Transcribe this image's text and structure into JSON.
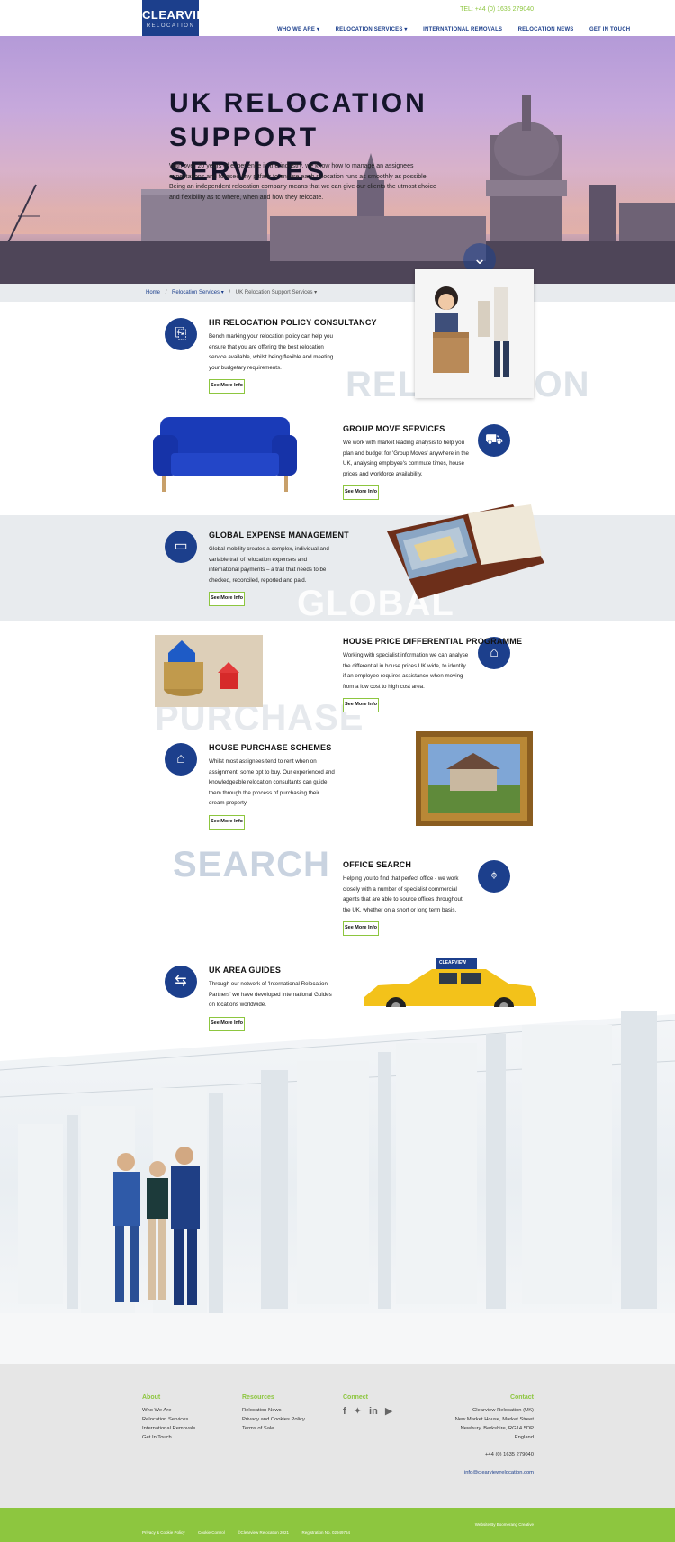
{
  "header": {
    "logo_line1": "CLEARVIEW",
    "logo_line2": "RELOCATION",
    "tel": "TEL: +44 (0) 1635 279040",
    "nav": [
      {
        "label": "WHO WE ARE ▾"
      },
      {
        "label": "RELOCATION SERVICES ▾"
      },
      {
        "label": "INTERNATIONAL REMOVALS"
      },
      {
        "label": "RELOCATION NEWS"
      },
      {
        "label": "GET IN TOUCH"
      }
    ]
  },
  "hero": {
    "title": "UK RELOCATION SUPPORT SERVICES",
    "body": "With over 20 years of experience in the industry, we know how to manage an assignees expectations and foresee any pitfalls to ensure each relocation runs as smoothly as possible. Being an independent relocation company means that we can give our clients the utmost choice and flexibility as to where, when and how they relocate.",
    "scroll_icon": "chevron-down-icon"
  },
  "breadcrumb": {
    "home": "Home",
    "sep": "/",
    "section": "Relocation Services ▾",
    "current": "UK Relocation Support Services ▾"
  },
  "services": [
    {
      "title": "HR RELOCATION POLICY CONSULTANCY",
      "text": "Bench marking your relocation policy can help you ensure that you are offering the best relocation service available, whilst being flexible and meeting your budgetary requirements.",
      "button": "See More Info",
      "icon": "policy-document-icon"
    },
    {
      "title": "GROUP MOVE SERVICES",
      "text": "We work with market leading analysis to help you plan and budget for 'Group Moves' anywhere in the UK, analysing employee's commute times, house prices and workforce availability.",
      "button": "See More Info",
      "icon": "moving-truck-icon"
    },
    {
      "title": "GLOBAL EXPENSE MANAGEMENT",
      "text": "Global mobility creates a complex, individual and variable trail of relocation expenses and international payments – a trail that needs to be checked, reconciled, reported and paid.",
      "button": "See More Info",
      "icon": "wallet-icon"
    },
    {
      "title": "HOUSE PRICE DIFFERENTIAL PROGRAMME",
      "text": "Working with specialist information we can analyse the differential in house prices UK wide, to identify if an employee requires assistance when moving from a low cost to high cost area.",
      "button": "See More Info",
      "icon": "house-chart-icon"
    },
    {
      "title": "HOUSE PURCHASE SCHEMES",
      "text": "Whilst most assignees tend to rent when on assignment, some opt to buy. Our experienced and knowledgeable relocation consultants can guide them through the process of purchasing their dream property.",
      "button": "See More Info",
      "icon": "house-sign-icon"
    },
    {
      "title": "OFFICE SEARCH",
      "text": "Helping you to find that perfect office - we work closely with a number of specialist commercial agents that are able to source offices throughout the UK, whether on a short or long term basis.",
      "button": "See More Info",
      "icon": "location-building-icon"
    },
    {
      "title": "UK AREA GUIDES",
      "text": "Through our network of 'International Relocation Partners' we have developed International Guides on locations worldwide.",
      "button": "See More Info",
      "icon": "signpost-icon"
    }
  ],
  "background_words": {
    "relocation": "RELOCATION",
    "global": "GLOBAL",
    "purchase": "PURCHASE",
    "search": "SEARCH"
  },
  "taxi_sign": "CLEARVIEW",
  "footer": {
    "about": {
      "heading": "About",
      "links": [
        "Who We Are",
        "Relocation Services",
        "International Removals",
        "Get In Touch"
      ]
    },
    "resources": {
      "heading": "Resources",
      "links": [
        "Relocation News",
        "Privacy and Cookies Policy",
        "Terms of Sale"
      ]
    },
    "connect": {
      "heading": "Connect",
      "icons": [
        "facebook-icon",
        "twitter-icon",
        "linkedin-icon",
        "youtube-icon"
      ]
    },
    "contact": {
      "heading": "Contact",
      "address": [
        "Clearview Relocation (UK)",
        "New Market House, Market Street",
        "Newbury, Berkshire, RG14 5DP",
        "England"
      ],
      "phone": "+44 (0) 1635 279040",
      "email": "info@clearviewrelocation.com"
    }
  },
  "footbar": {
    "items": [
      "Privacy & Cookie Policy",
      "Cookie Control",
      "©Clearview Relocation 2021",
      "Registration No. 02949764"
    ],
    "credit": "Website By Boomerang Creative"
  },
  "colors": {
    "brand_blue": "#1c3f8c",
    "accent_green": "#8dc63f",
    "band_grey": "#e8ebee"
  }
}
